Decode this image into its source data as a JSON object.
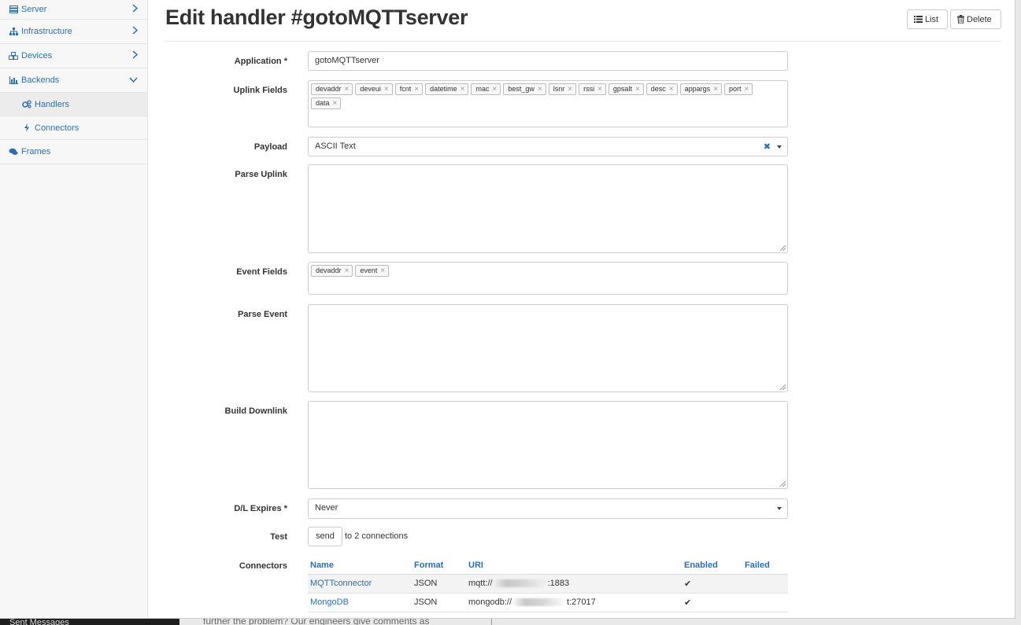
{
  "background": {
    "footer_dark_text": "Sent Messages",
    "footer_text": "further the problem? Our engineers give comments as"
  },
  "sidebar": {
    "items": [
      {
        "label": "Server",
        "icon": "server-icon",
        "expanded": false
      },
      {
        "label": "Infrastructure",
        "icon": "sitemap-icon",
        "expanded": false
      },
      {
        "label": "Devices",
        "icon": "cubes-icon",
        "expanded": false
      },
      {
        "label": "Backends",
        "icon": "bar-chart-icon",
        "expanded": true
      },
      {
        "label": "Handlers",
        "icon": "cogs-icon",
        "active": true
      },
      {
        "label": "Connectors",
        "icon": "bolt-icon"
      },
      {
        "label": "Frames",
        "icon": "comments-icon"
      }
    ]
  },
  "page": {
    "title": "Edit handler #gotoMQTTserver",
    "list_label": "List",
    "delete_label": "Delete"
  },
  "form": {
    "application": {
      "label": "Application *",
      "value": "gotoMQTTserver"
    },
    "uplink_fields": {
      "label": "Uplink Fields",
      "tags": [
        "devaddr",
        "deveui",
        "fcnt",
        "datetime",
        "mac",
        "best_gw",
        "lsnr",
        "rssi",
        "gpsalt",
        "desc",
        "appargs",
        "port",
        "data"
      ]
    },
    "payload": {
      "label": "Payload",
      "value": "ASCII Text"
    },
    "parse_uplink": {
      "label": "Parse Uplink",
      "value": ""
    },
    "event_fields": {
      "label": "Event Fields",
      "tags": [
        "devaddr",
        "event"
      ]
    },
    "parse_event": {
      "label": "Parse Event",
      "value": ""
    },
    "build_downlink": {
      "label": "Build Downlink",
      "value": ""
    },
    "dl_expires": {
      "label": "D/L Expires *",
      "value": "Never"
    },
    "test": {
      "label": "Test",
      "button": "send",
      "note": "to 2 connections"
    },
    "connectors": {
      "label": "Connectors",
      "columns": [
        "Name",
        "Format",
        "URI",
        "Enabled",
        "Failed"
      ],
      "rows": [
        {
          "name": "MQTTconnector",
          "format": "JSON",
          "uri_prefix": "mqtt://",
          "uri_suffix": ":1883",
          "enabled": "✔",
          "failed": ""
        },
        {
          "name": "MongoDB",
          "format": "JSON",
          "uri_prefix": "mongodb://",
          "uri_suffix": "t:27017",
          "enabled": "✔",
          "failed": ""
        }
      ]
    }
  },
  "colors": {
    "link": "#2a6fb5",
    "sidebar_bg": "#f7f7f7"
  }
}
